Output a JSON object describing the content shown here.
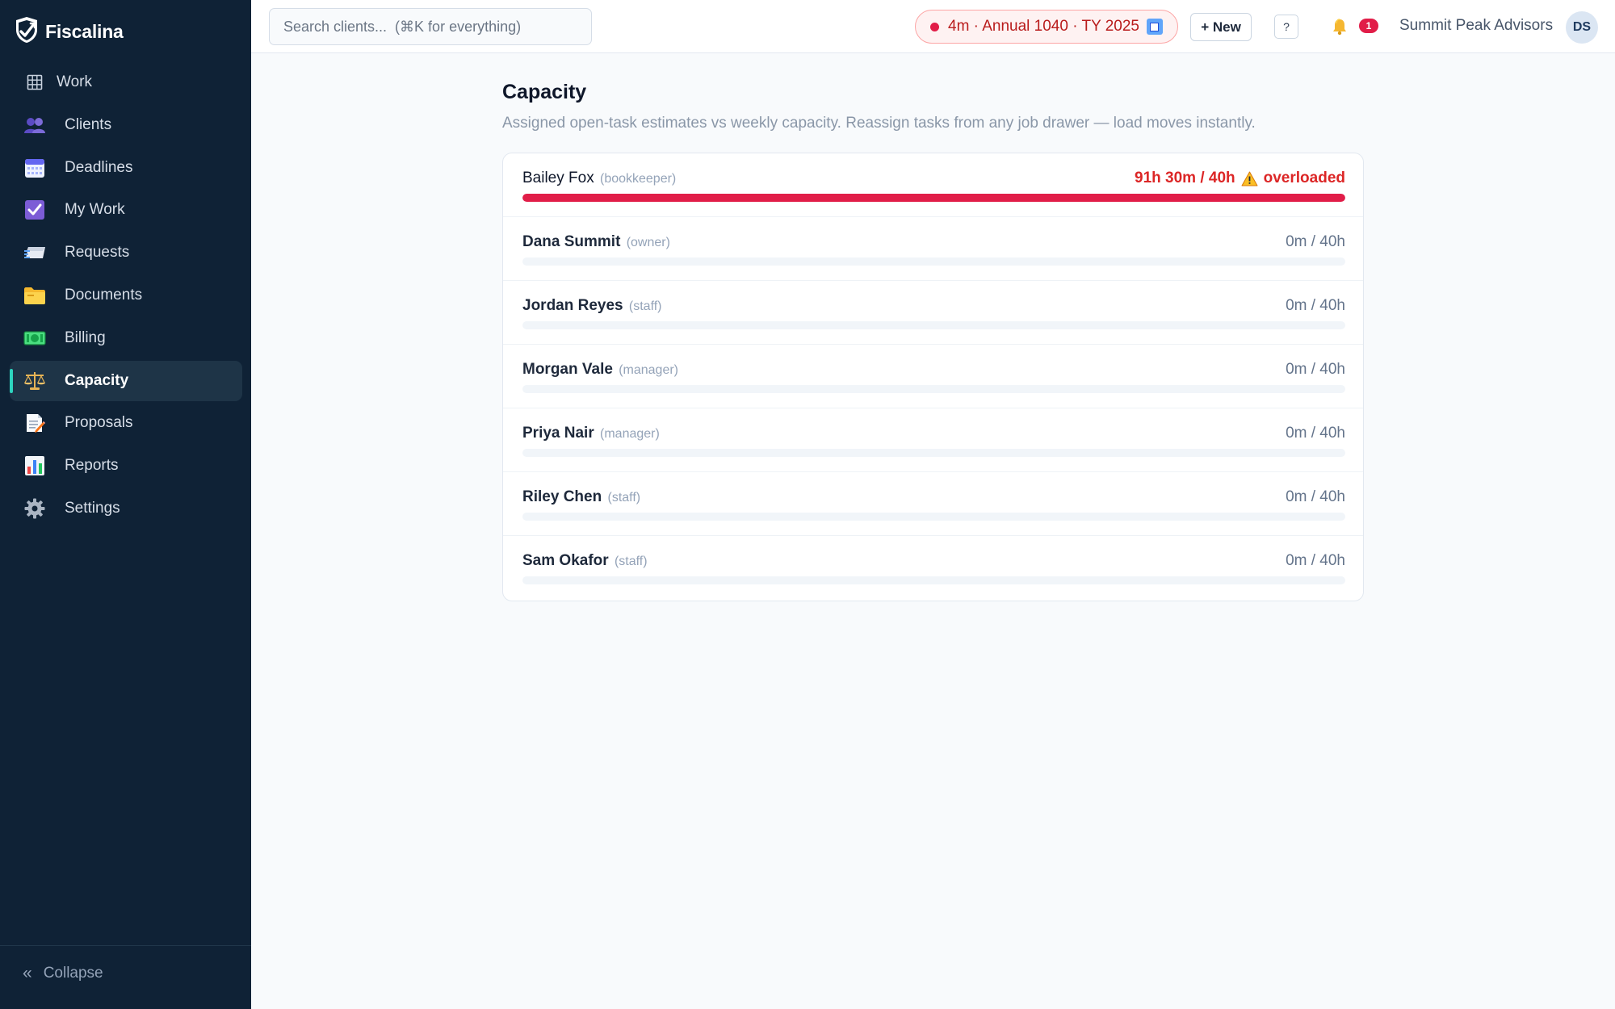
{
  "app": {
    "name": "Fiscalina"
  },
  "sidebar": {
    "items": [
      {
        "label": "Work",
        "icon": "grid-icon"
      },
      {
        "label": "Clients",
        "icon": "users-icon"
      },
      {
        "label": "Deadlines",
        "icon": "calendar-icon"
      },
      {
        "label": "My Work",
        "icon": "checkbox-icon"
      },
      {
        "label": "Requests",
        "icon": "inbox-icon"
      },
      {
        "label": "Documents",
        "icon": "folder-icon"
      },
      {
        "label": "Billing",
        "icon": "money-icon"
      },
      {
        "label": "Capacity",
        "icon": "scales-icon",
        "active": true
      },
      {
        "label": "Proposals",
        "icon": "memo-icon"
      },
      {
        "label": "Reports",
        "icon": "bar-chart-icon"
      },
      {
        "label": "Settings",
        "icon": "gear-icon"
      }
    ],
    "collapse_icon": "«",
    "collapse_label": "Collapse"
  },
  "topbar": {
    "search_placeholder": "Search clients...  (⌘K for everything)",
    "timer_text": "4m · Annual 1040 · TY 2025",
    "new_label": "+ New",
    "help_label": "?",
    "notification_count": "1",
    "org_name": "Summit Peak Advisors",
    "avatar_initials": "DS"
  },
  "main": {
    "title": "Capacity",
    "subtitle": "Assigned open-task estimates vs weekly capacity. Reassign tasks from any job drawer — load moves instantly.",
    "staff": [
      {
        "name": "Bailey Fox",
        "role": "(bookkeeper)",
        "load": "91h 30m / 40h",
        "status": "overloaded",
        "load_fraction": 1.0
      },
      {
        "name": "Dana Summit",
        "role": "(owner)",
        "load": "0m / 40h",
        "load_fraction": 0
      },
      {
        "name": "Jordan Reyes",
        "role": "(staff)",
        "load": "0m / 40h",
        "load_fraction": 0
      },
      {
        "name": "Morgan Vale",
        "role": "(manager)",
        "load": "0m / 40h",
        "load_fraction": 0
      },
      {
        "name": "Priya Nair",
        "role": "(manager)",
        "load": "0m / 40h",
        "load_fraction": 0
      },
      {
        "name": "Riley Chen",
        "role": "(staff)",
        "load": "0m / 40h",
        "load_fraction": 0
      },
      {
        "name": "Sam Okafor",
        "role": "(staff)",
        "load": "0m / 40h",
        "load_fraction": 0
      }
    ]
  },
  "colors": {
    "sidebar_bg": "#0f2236",
    "accent": "#2dd4bf",
    "overload": "#dc2626",
    "bar_fill": "#e11d48"
  }
}
